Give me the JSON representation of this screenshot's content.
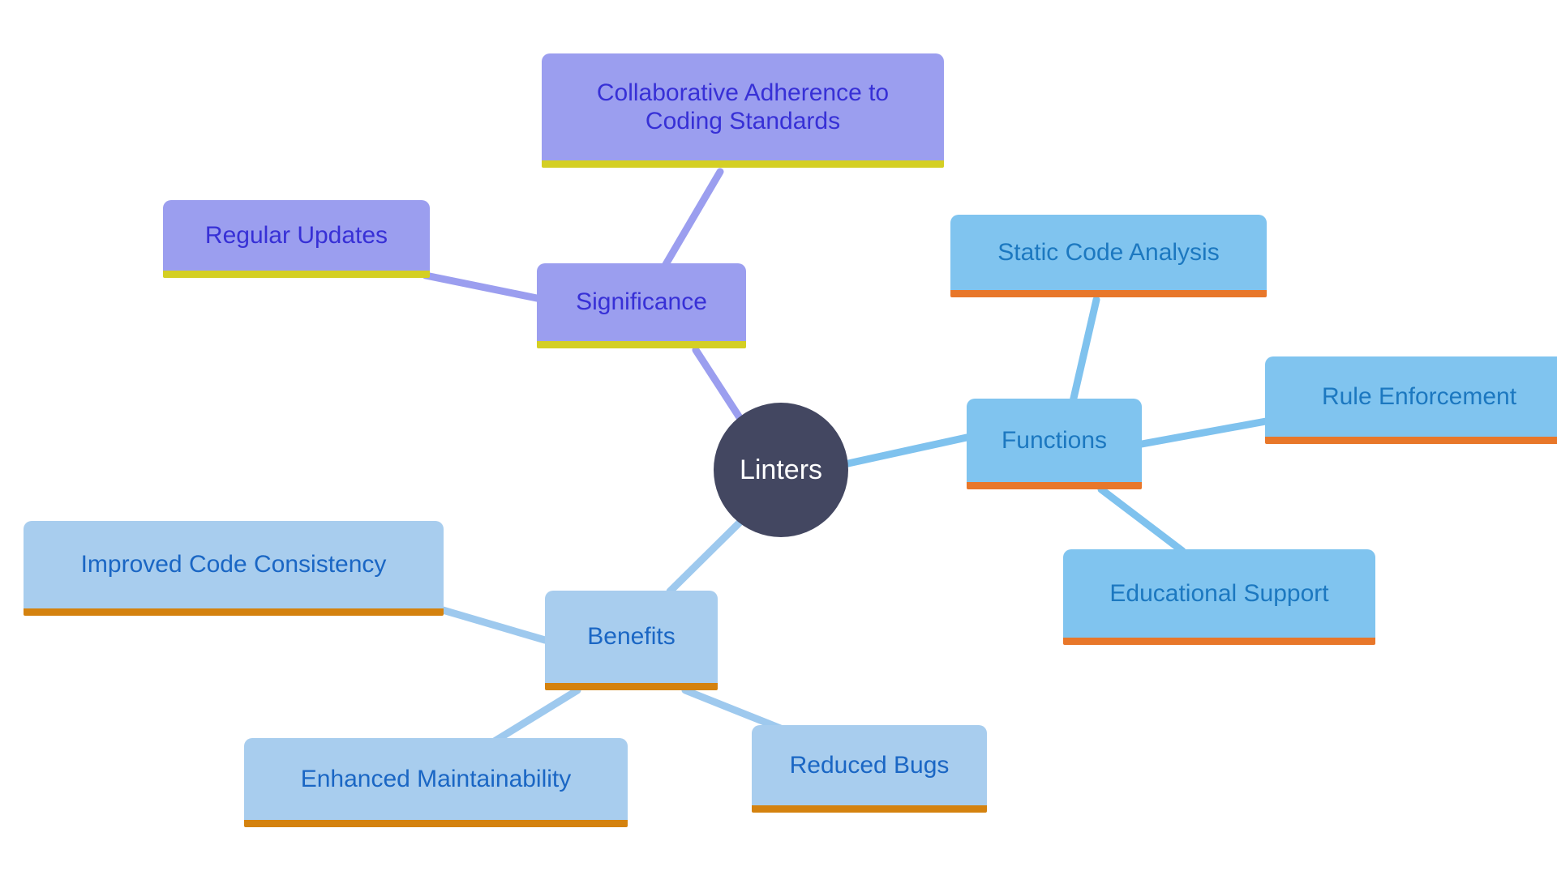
{
  "diagram": {
    "type": "mind-map",
    "title": "Linters",
    "background_color": "#ffffff",
    "palette": {
      "root_fill": "#434761",
      "root_text": "#ffffff",
      "purple_fill": "#9b9eef",
      "purple_text": "#3730d6",
      "purple_underline": "#d4cf23",
      "blue_fill": "#80c4ef",
      "blue_text": "#1c78c0",
      "blue_underline": "#e8772a",
      "lightblue_fill": "#a8cdee",
      "lightblue_text": "#1a66c4",
      "lightblue_underline": "#d4820f",
      "edge_purple": "#9b9eef",
      "edge_blue": "#7fc2ee",
      "edge_lightblue": "#9ec9ee"
    },
    "root": {
      "id": "linters",
      "label": "Linters"
    },
    "branches": [
      {
        "id": "significance",
        "label": "Significance",
        "theme": "purple",
        "children": [
          {
            "id": "collaborative-adherence",
            "label": "Collaborative Adherence to\nCoding Standards"
          },
          {
            "id": "regular-updates",
            "label": "Regular Updates"
          }
        ]
      },
      {
        "id": "functions",
        "label": "Functions",
        "theme": "blue",
        "children": [
          {
            "id": "static-code-analysis",
            "label": "Static Code Analysis"
          },
          {
            "id": "rule-enforcement",
            "label": "Rule Enforcement"
          },
          {
            "id": "educational-support",
            "label": "Educational Support"
          }
        ]
      },
      {
        "id": "benefits",
        "label": "Benefits",
        "theme": "lightblue",
        "children": [
          {
            "id": "improved-code-consistency",
            "label": "Improved Code Consistency"
          },
          {
            "id": "enhanced-maintainability",
            "label": "Enhanced Maintainability"
          },
          {
            "id": "reduced-bugs",
            "label": "Reduced Bugs"
          }
        ]
      }
    ],
    "edges": [
      {
        "from": "linters",
        "to": "significance",
        "color": "#9b9eef"
      },
      {
        "from": "significance",
        "to": "collaborative-adherence",
        "color": "#9b9eef"
      },
      {
        "from": "significance",
        "to": "regular-updates",
        "color": "#9b9eef"
      },
      {
        "from": "linters",
        "to": "functions",
        "color": "#7fc2ee"
      },
      {
        "from": "functions",
        "to": "static-code-analysis",
        "color": "#7fc2ee"
      },
      {
        "from": "functions",
        "to": "rule-enforcement",
        "color": "#7fc2ee"
      },
      {
        "from": "functions",
        "to": "educational-support",
        "color": "#7fc2ee"
      },
      {
        "from": "linters",
        "to": "benefits",
        "color": "#9ec9ee"
      },
      {
        "from": "benefits",
        "to": "improved-code-consistency",
        "color": "#9ec9ee"
      },
      {
        "from": "benefits",
        "to": "enhanced-maintainability",
        "color": "#9ec9ee"
      },
      {
        "from": "benefits",
        "to": "reduced-bugs",
        "color": "#9ec9ee"
      }
    ]
  }
}
